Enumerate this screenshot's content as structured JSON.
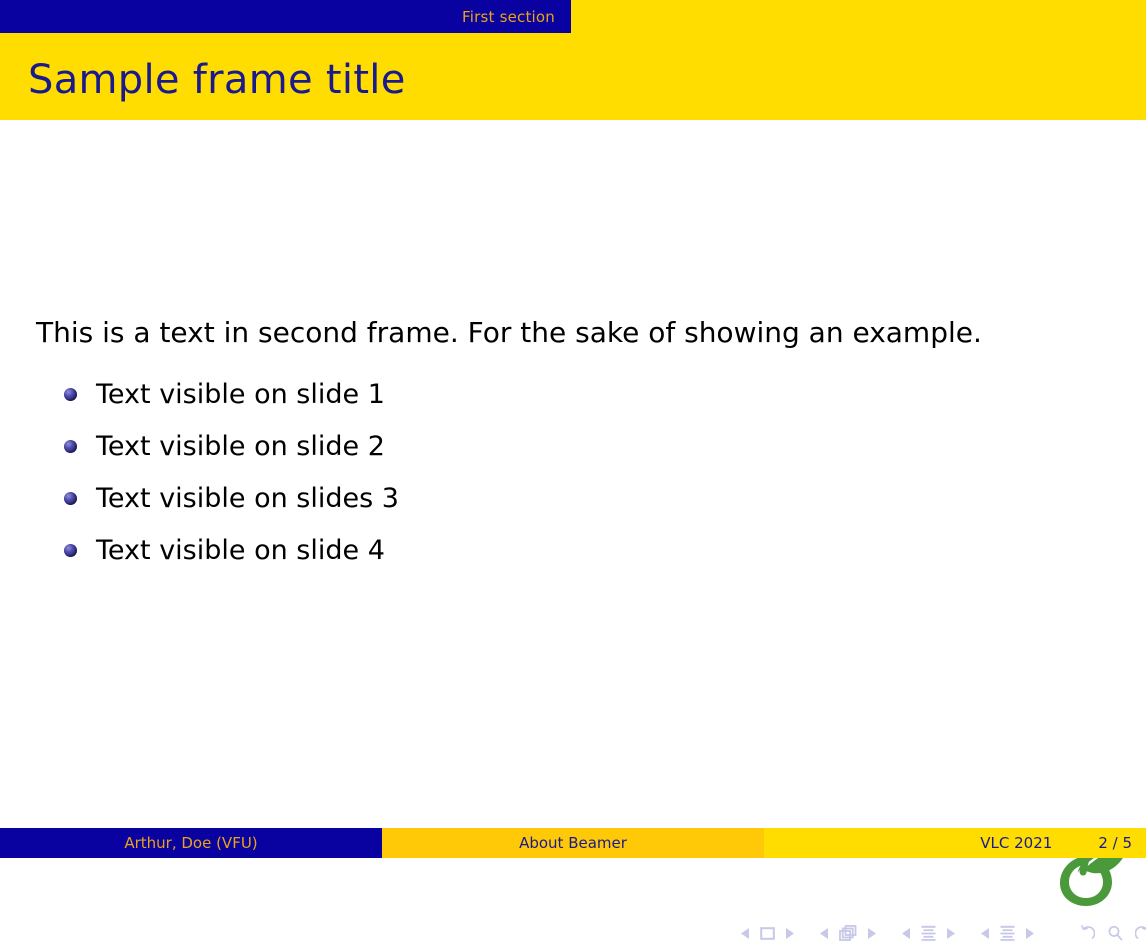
{
  "header": {
    "section_label": "First section",
    "frame_title": "Sample frame title"
  },
  "body": {
    "paragraph": "This is a text in second frame. For the sake of showing an example.",
    "bullets": [
      {
        "label": "Text visible on slide 1"
      },
      {
        "label": "Text visible on slide 2"
      },
      {
        "label": "Text visible on slides 3"
      },
      {
        "label": "Text visible on slide 4"
      }
    ]
  },
  "logo": {
    "name": "overleaf-logo",
    "color": "#4A9A3C"
  },
  "navigation_symbols": {
    "groups": [
      {
        "prev": "◀",
        "icon": "slide-icon",
        "next": "▶"
      },
      {
        "prev": "◀",
        "icon": "frame-stack-icon",
        "next": "▶"
      },
      {
        "prev": "◀",
        "icon": "subsection-icon",
        "next": "▶"
      },
      {
        "prev": "◀",
        "icon": "section-icon",
        "next": "▶"
      }
    ],
    "doc_icon": "document-icon",
    "back_icon": "↺",
    "search_icon": "search-icon",
    "forward_icon": "↻"
  },
  "footer": {
    "author": "Arthur, Doe  (VFU)",
    "title": "About Beamer",
    "date": "VLC 2021",
    "page": "2 / 5"
  },
  "colors": {
    "structure_blue": "#0A02A0",
    "title_navy": "#1A1A8C",
    "bright_yellow": "#FFDD00",
    "gold": "#FFC907",
    "amber_text": "#E8A317",
    "logo_green": "#4A9A3C",
    "nav_symbol": "#C8C8E8"
  }
}
